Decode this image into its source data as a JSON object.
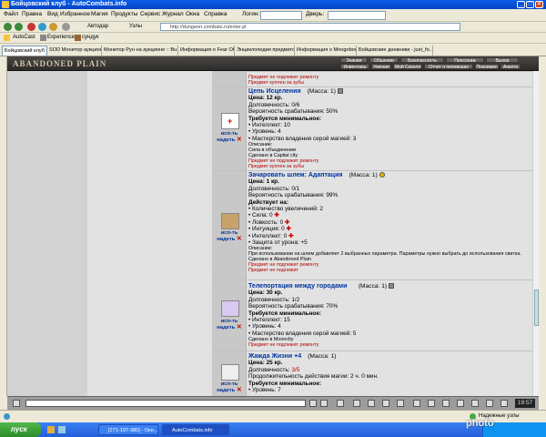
{
  "window": {
    "title": "Бойцовский клуб - AutoCombats.info"
  },
  "menu": {
    "items": [
      "Файл",
      "Правка",
      "Вид",
      "Избранное",
      "Магия",
      "Продукты",
      "Сервис",
      "Журнал",
      "Окна",
      "Справка"
    ],
    "login_label": "Логин:",
    "door_label": "Дверь:"
  },
  "toolbar": {
    "autodar": "Автодар",
    "nodes": "Узлы",
    "address": "http://dungeon.combats.ru/enter.pl"
  },
  "toolbar2": {
    "autocast": "AutoCast",
    "experience": "Experience",
    "chest": "сундук"
  },
  "tabs": [
    "Бойцовский клуб",
    "SOD Монитор аукциона",
    "Монитор Рун на аукционе :: Bu...",
    "Информация о Fear Off",
    "Энциклопедия предметов",
    "Информация о Mnogoboec",
    "Бойцовские дневники - just_fo..."
  ],
  "game": {
    "logo": "ABANDONED PLAIN",
    "nav_top": [
      "Знания",
      "Общение",
      "Безопасность",
      "Персонаж",
      "Выход"
    ],
    "nav_bottom": [
      "Инвентарь",
      "Умения",
      "Мой Скролл",
      "Отчет о переводах",
      "Покормил",
      "Анкета"
    ]
  },
  "actions": {
    "use": "исп-ть",
    "wear": "надеть"
  },
  "top_fragment": {
    "line1": "Предмет не подлежит ремонту",
    "line2": "Предмет куплен за зубы"
  },
  "items": [
    {
      "name": "Цепь Исцеления",
      "mass": "(Масса: 1)",
      "price": "Цена: 12 кр.",
      "durability": "Долговечность: 0/6",
      "chance": "Вероятность срабатывания: 50%",
      "req_title": "Требуется минимальное:",
      "reqs": [
        "• Интеллект: 10",
        "• Уровень: 4",
        "• Мастерство владения серой магией: 3"
      ],
      "desc_title": "Описание:",
      "desc": "Сила в объединении",
      "made": "Сделано в Capital city",
      "notes": [
        "Предмет не подлежит ремонту",
        "Предмет куплен за зубы"
      ]
    },
    {
      "name": "Зачаровать шлем: Адаптация",
      "mass": "(Масса: 1)",
      "price": "Цена: 1 кр.",
      "durability": "Долговечность: 0/1",
      "chance": "Вероятность срабатывания: 99%",
      "eff_title": "Действует на:",
      "effects": [
        "• Количество увеличений: 2",
        "• Сила: 0",
        "• Ловкость: 0",
        "• Интуиция: 0",
        "• Интеллект: 0",
        "• Защита от урона: +5"
      ],
      "desc_title": "Описание:",
      "desc": "При использовании на шлем добавляет 2 выбранных параметра. Параметры нужно выбрать до использования свитка.",
      "made": "Сделано в Abandoned Plain",
      "notes": [
        "Предмет не подлежит ремонту",
        "Предмет не подлежит"
      ]
    },
    {
      "name": "Телепортация между городами",
      "mass": "(Масса: 1)",
      "price": "Цена: 30 кр.",
      "durability": "Долговечность: 1/2",
      "chance": "Вероятность срабатывания: 70%",
      "req_title": "Требуется минимальное:",
      "reqs": [
        "• Интеллект: 15",
        "• Уровень: 4",
        "• Мастерство владения серой магией: 5"
      ],
      "made": "Сделано в Moonclty",
      "notes": [
        "Предмет не подлежит ремонту"
      ]
    },
    {
      "name": "Жажда Жизни +4",
      "mass": "(Масса: 1)",
      "price": "Цена: 25 кр.",
      "durability_label": "Долговечность:",
      "durability_value": "3/5",
      "duration": "Продолжительность действия магии: 2 ч. 0 мин.",
      "req_title": "Требуется минимальное:",
      "reqs": [
        "• Уровень: 7"
      ]
    }
  ],
  "bottom": {
    "clock": "19:57"
  },
  "status": {
    "text": "Надежные узлы"
  },
  "taskbar": {
    "start": "пуск",
    "tasks": [
      "[271-197-380] - Окн...",
      "AutoCombats.info"
    ]
  },
  "watermark": "photo"
}
